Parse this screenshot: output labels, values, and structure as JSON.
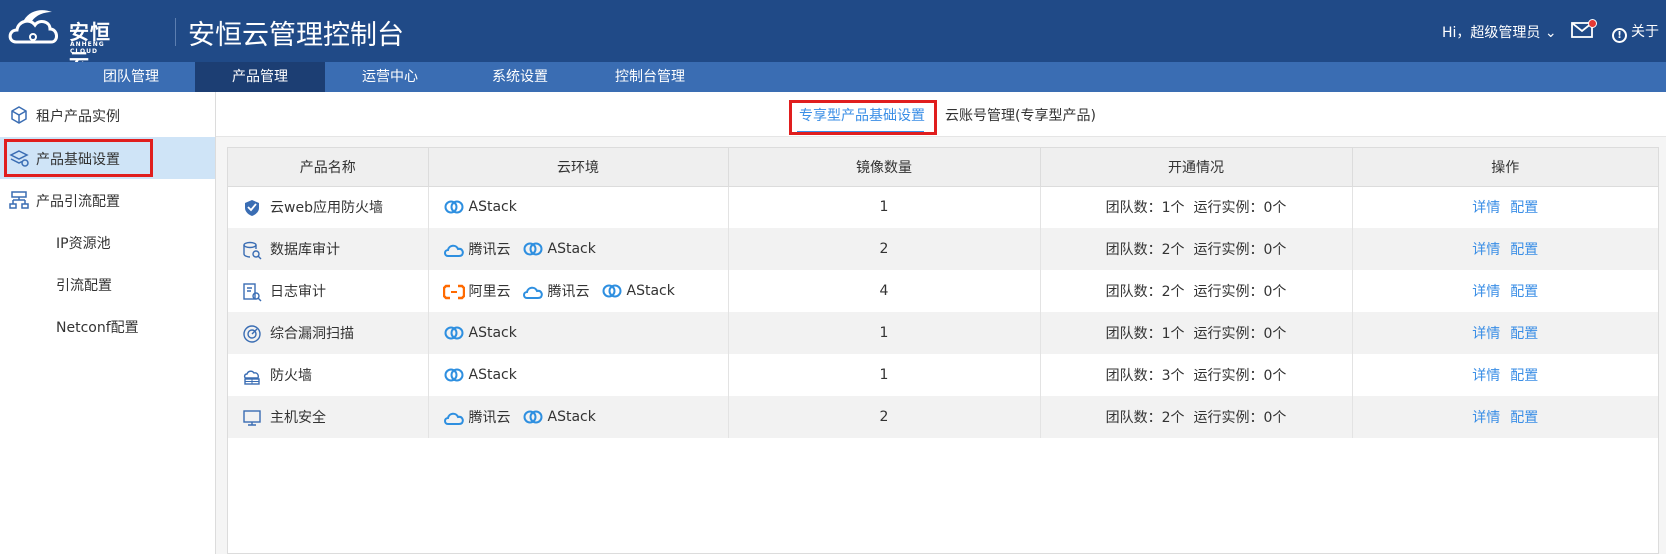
{
  "header": {
    "logo_text": "安恒云",
    "logo_sub": "ANHENG CLOUD",
    "title": "安恒云管理控制台",
    "user_label": "Hi，超级管理员",
    "about_label": "关于"
  },
  "nav": {
    "items": [
      "团队管理",
      "产品管理",
      "运营中心",
      "系统设置",
      "控制台管理"
    ],
    "active_index": 1
  },
  "sidebar": {
    "items": [
      {
        "label": "租户产品实例",
        "icon": "cube-icon"
      },
      {
        "label": "产品基础设置",
        "icon": "layers-gear-icon"
      },
      {
        "label": "产品引流配置",
        "icon": "sitemap-icon"
      },
      {
        "label": "IP资源池",
        "icon": ""
      },
      {
        "label": "引流配置",
        "icon": ""
      },
      {
        "label": "Netconf配置",
        "icon": ""
      }
    ],
    "active_index": 1
  },
  "tabs": {
    "items": [
      "专享型产品基础设置",
      "云账号管理(专享型产品)"
    ],
    "active_index": 0
  },
  "table": {
    "headers": [
      "产品名称",
      "云环境",
      "镜像数量",
      "开通情况",
      "操作"
    ],
    "rows": [
      {
        "name": "云web应用防火墙",
        "icon": "shield-icon",
        "envs": [
          "AStack"
        ],
        "images": "1",
        "status": "团队数：1个  运行实例：0个"
      },
      {
        "name": "数据库审计",
        "icon": "database-search-icon",
        "envs": [
          "腾讯云",
          "AStack"
        ],
        "images": "2",
        "status": "团队数：2个  运行实例：0个"
      },
      {
        "name": "日志审计",
        "icon": "log-search-icon",
        "envs": [
          "阿里云",
          "腾讯云",
          "AStack"
        ],
        "images": "4",
        "status": "团队数：2个  运行实例：0个"
      },
      {
        "name": "综合漏洞扫描",
        "icon": "scan-icon",
        "envs": [
          "AStack"
        ],
        "images": "1",
        "status": "团队数：1个  运行实例：0个"
      },
      {
        "name": "防火墙",
        "icon": "firewall-icon",
        "envs": [
          "AStack"
        ],
        "images": "1",
        "status": "团队数：3个  运行实例：0个"
      },
      {
        "name": "主机安全",
        "icon": "monitor-icon",
        "envs": [
          "腾讯云",
          "AStack"
        ],
        "images": "2",
        "status": "团队数：2个  运行实例：0个"
      }
    ],
    "actions": [
      "详情",
      "配置"
    ]
  },
  "colors": {
    "header_bg": "#204a87",
    "nav_bg": "#3a6db3",
    "nav_active_bg": "#1c3e73",
    "link": "#3a8ee6",
    "highlight_box": "#e01e1e",
    "aliyun_orange": "#ff6a00"
  }
}
